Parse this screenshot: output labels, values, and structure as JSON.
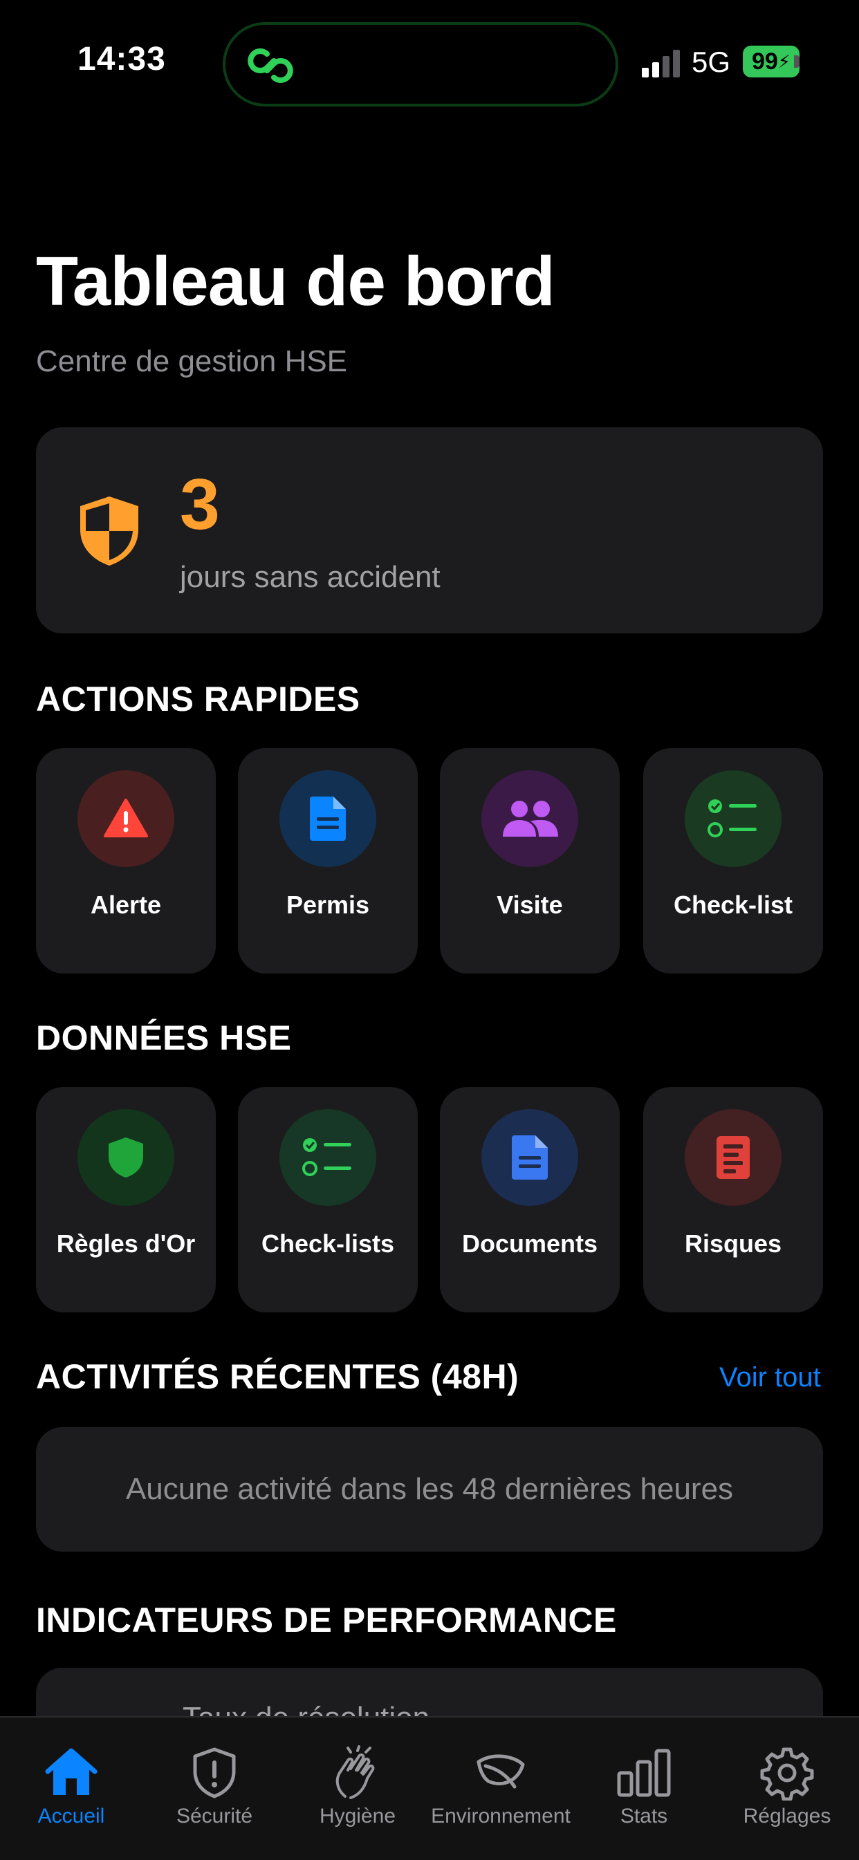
{
  "status": {
    "time": "14:33",
    "network": "5G",
    "battery": "99"
  },
  "header": {
    "title": "Tableau de bord",
    "subtitle": "Centre de gestion HSE"
  },
  "accident": {
    "count": "3",
    "label": "jours sans accident"
  },
  "quick_actions": {
    "title": "ACTIONS RAPIDES",
    "items": [
      {
        "label": "Alerte",
        "icon": "warning-icon",
        "color": "#ff453a"
      },
      {
        "label": "Permis",
        "icon": "document-icon",
        "color": "#0a84ff"
      },
      {
        "label": "Visite",
        "icon": "people-icon",
        "color": "#bf5af2"
      },
      {
        "label": "Check-list",
        "icon": "checklist-icon",
        "color": "#30d158"
      }
    ]
  },
  "hse_data": {
    "title": "DONNÉES HSE",
    "items": [
      {
        "label": "Règles d'Or",
        "icon": "shield-icon",
        "color": "#1fa53a"
      },
      {
        "label": "Check-lists",
        "icon": "checklist-icon",
        "color": "#30d158"
      },
      {
        "label": "Documents",
        "icon": "document-icon",
        "color": "#3a78f2"
      },
      {
        "label": "Risques",
        "icon": "risk-list-icon",
        "color": "#e0413a"
      }
    ]
  },
  "recent": {
    "title": "ACTIVITÉS RÉCENTES (48H)",
    "see_all": "Voir tout",
    "empty": "Aucune activité dans les 48 dernières heures"
  },
  "kpi": {
    "title": "INDICATEURS DE PERFORMANCE",
    "partial_text": "Taux de résolution"
  },
  "tabs": [
    {
      "label": "Accueil",
      "icon": "home-icon",
      "active": true
    },
    {
      "label": "Sécurité",
      "icon": "shield-alert-icon",
      "active": false
    },
    {
      "label": "Hygiène",
      "icon": "clap-hands-icon",
      "active": false
    },
    {
      "label": "Environnement",
      "icon": "leaf-icon",
      "active": false
    },
    {
      "label": "Stats",
      "icon": "bar-chart-icon",
      "active": false
    },
    {
      "label": "Réglages",
      "icon": "gear-icon",
      "active": false
    }
  ],
  "colors": {
    "accent": "#0a84ff",
    "orange": "#ff9f2e",
    "card": "#1c1c1e"
  }
}
